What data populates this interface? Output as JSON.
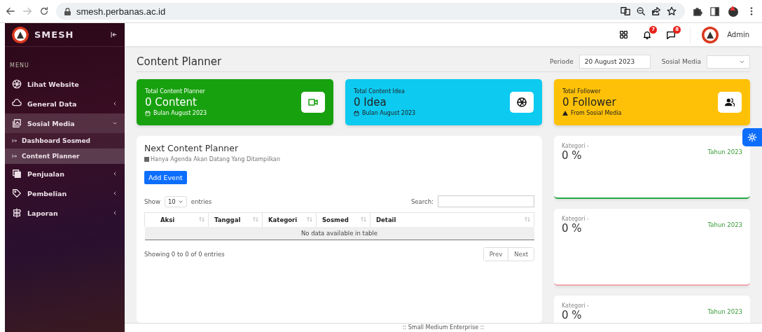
{
  "browser": {
    "url": "smesh.perbanas.ac.id"
  },
  "sidebar": {
    "brand": "SMESH",
    "menu_label": "MENU",
    "items": [
      {
        "label": "Lihat Website",
        "kind": "link",
        "selected": false
      },
      {
        "label": "General Data",
        "kind": "group",
        "expanded": false,
        "selected": false
      },
      {
        "label": "Sosial Media",
        "kind": "group",
        "expanded": true,
        "selected": true,
        "children": [
          {
            "label": "Dashboard Sosmed",
            "selected": false
          },
          {
            "label": "Content Planner",
            "selected": true
          }
        ]
      },
      {
        "label": "Penjualan",
        "kind": "group",
        "expanded": false,
        "selected": false
      },
      {
        "label": "Pembelian",
        "kind": "group",
        "expanded": false,
        "selected": false
      },
      {
        "label": "Laporan",
        "kind": "group",
        "expanded": false,
        "selected": false
      }
    ]
  },
  "header": {
    "notifications": "7",
    "messages": "8",
    "user": "Admin"
  },
  "page": {
    "title": "Content Planner",
    "period_label": "Periode",
    "period_value": "20 August 2023",
    "social_label": "Sosial Media"
  },
  "stats": [
    {
      "label": "Total Content Planner",
      "value": "0 Content",
      "sub": "Bulan August 2023",
      "color": "#18a10f"
    },
    {
      "label": "Total Content Idea",
      "value": "0 Idea",
      "sub": "Bulan August 2023",
      "color": "#0dcaf0"
    },
    {
      "label": "Total Follower",
      "value": "0 Follower",
      "sub": "From Sosial Media",
      "color": "#ffc107"
    }
  ],
  "planner": {
    "title": "Next Content Planner",
    "subtitle": "Hanya Agenda Akan Datang Yang Ditampilkan",
    "add_button": "Add Event",
    "show_label": "Show",
    "page_size": "10",
    "entries_label": "entries",
    "search_label": "Search:",
    "columns": [
      "Aksi",
      "Tanggal",
      "Kategori",
      "Sosmed",
      "Detail"
    ],
    "empty_message": "No data available in table",
    "info": "Showing 0 to 0 of 0 entries",
    "pagination": [
      "Prev",
      "Next"
    ]
  },
  "categories": [
    {
      "label": "Kategori -",
      "value": "0 %",
      "year": "Tahun 2023",
      "color": "#28a745"
    },
    {
      "label": "Kategori -",
      "value": "0 %",
      "year": "Tahun 2023",
      "color": "#f1a7b0"
    },
    {
      "label": "Kategori -",
      "value": "0 %",
      "year": "Tahun 2023"
    }
  ],
  "footer": ":: Small Medium Enterprise ::"
}
